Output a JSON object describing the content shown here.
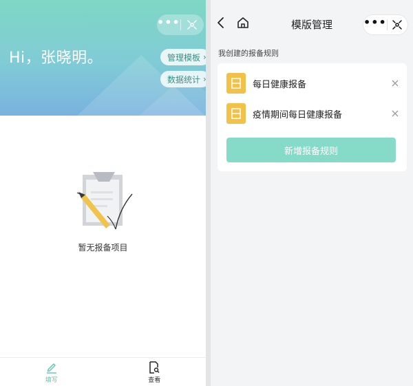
{
  "left": {
    "greeting": "Hi，张晓明。",
    "menu_dots": "•••",
    "pills": [
      {
        "label": "管理模板",
        "chevron": "›"
      },
      {
        "label": "数据统计",
        "chevron": "›"
      }
    ],
    "empty_text": "暂无报备项目",
    "tabs": [
      {
        "label": "填写",
        "icon": "pencil-icon",
        "active": true
      },
      {
        "label": "查看",
        "icon": "document-search-icon",
        "active": false
      }
    ],
    "colors": {
      "accent": "#58c7b1",
      "hero_top": "#7fd7c5",
      "hero_bottom": "#79b2df"
    }
  },
  "right": {
    "nav": {
      "title": "模版管理",
      "back_icon": "chevron-left-icon",
      "home_icon": "home-icon",
      "menu_dots": "•••"
    },
    "section_label": "我创建的报备规则",
    "rules": [
      {
        "title": "每日健康报备",
        "icon": "calendar-icon"
      },
      {
        "title": "疫情期间每日健康报备",
        "icon": "calendar-icon"
      }
    ],
    "add_button": "新增报备规则",
    "colors": {
      "rule_icon_bg": "#f2c248",
      "button_bg": "#86dac8"
    }
  }
}
